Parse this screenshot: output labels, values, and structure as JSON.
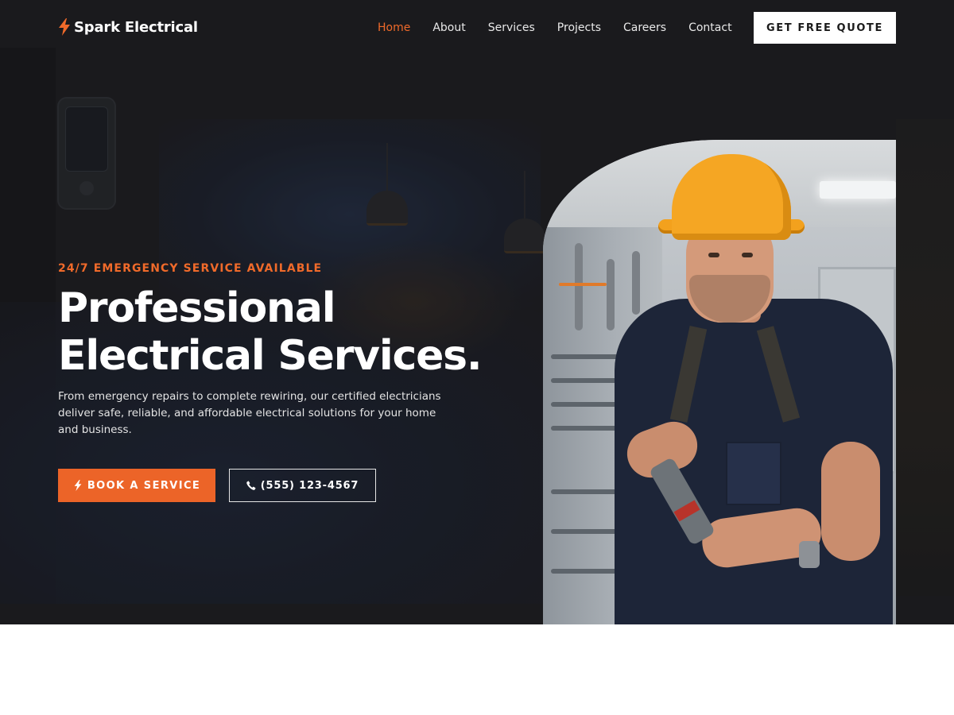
{
  "brand": {
    "name": "Spark Electrical",
    "icon": "lightning-bolt-icon",
    "accent": "#f06a2a"
  },
  "nav": {
    "items": [
      {
        "label": "Home",
        "active": true
      },
      {
        "label": "About",
        "active": false
      },
      {
        "label": "Services",
        "active": false
      },
      {
        "label": "Projects",
        "active": false
      },
      {
        "label": "Careers",
        "active": false
      },
      {
        "label": "Contact",
        "active": false
      }
    ],
    "cta_label": "GET FREE QUOTE"
  },
  "hero": {
    "eyebrow": "24/7 EMERGENCY SERVICE AVAILABLE",
    "headline_line1": "Professional",
    "headline_line2": "Electrical Services.",
    "description": "From emergency repairs to complete rewiring, our certified electricians deliver safe, reliable, and affordable electrical solutions for your home and business.",
    "primary_button": {
      "label": "BOOK A SERVICE",
      "icon": "lightning-bolt-icon"
    },
    "secondary_button": {
      "label": "(555) 123-4567",
      "icon": "phone-icon"
    },
    "image": "electrician-photo"
  },
  "colors": {
    "hero_bg": "#1f1f22",
    "primary_button": "#ec6428",
    "cta_bg": "#ffffff"
  }
}
